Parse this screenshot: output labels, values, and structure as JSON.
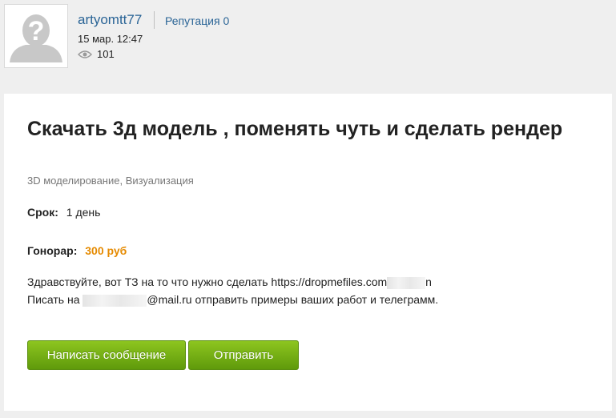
{
  "header": {
    "username": "artyomtt77",
    "reputation": "Репутация 0",
    "date": "15 мар. 12:47",
    "views": "101"
  },
  "task": {
    "title": "Скачать 3д модель , поменять чуть и сделать рендер",
    "categories": "3D моделирование, Визуализация",
    "deadline_label": "Срок:",
    "deadline_value": "1 день",
    "fee_label": "Гонорар:",
    "fee_value": "300 руб",
    "desc_line1_before": "Здравствуйте, вот ТЗ на то что нужно сделать https://dropmefiles.com",
    "desc_line1_after": "n",
    "desc_line2_before": "Писать на ",
    "desc_line2_after": "@mail.ru отправить примеры ваших работ и телеграмм."
  },
  "buttons": {
    "message": "Написать сообщение",
    "send": "Отправить"
  },
  "colors": {
    "link": "#2a6496",
    "fee": "#e58a00",
    "button": "#6fae12"
  }
}
